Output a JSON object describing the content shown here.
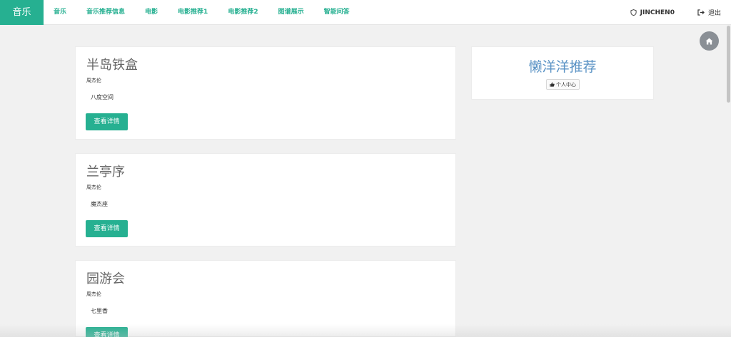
{
  "navbar": {
    "brand": "音乐",
    "items": [
      {
        "label": "音乐"
      },
      {
        "label": "音乐推荐信息"
      },
      {
        "label": "电影"
      },
      {
        "label": "电影推荐1"
      },
      {
        "label": "电影推荐2"
      },
      {
        "label": "图谱展示"
      },
      {
        "label": "智能问答"
      }
    ],
    "user": "JINCHEN0",
    "logout": "退出",
    "accent_color": "#26b091"
  },
  "songs": [
    {
      "title": "半岛铁盒",
      "artist": "周杰伦",
      "album": "八度空间",
      "button": "查看详情"
    },
    {
      "title": "兰亭序",
      "artist": "周杰伦",
      "album": "魔杰座",
      "button": "查看详情"
    },
    {
      "title": "园游会",
      "artist": "周杰伦",
      "album": "七里香",
      "button": "查看详情"
    }
  ],
  "panel": {
    "heading": "懒洋洋推荐",
    "profile_button": "个人中心"
  },
  "icons": {
    "user": "shield-icon",
    "logout": "sign-out-icon",
    "home": "home-icon",
    "profile": "thumbs-up-icon"
  }
}
